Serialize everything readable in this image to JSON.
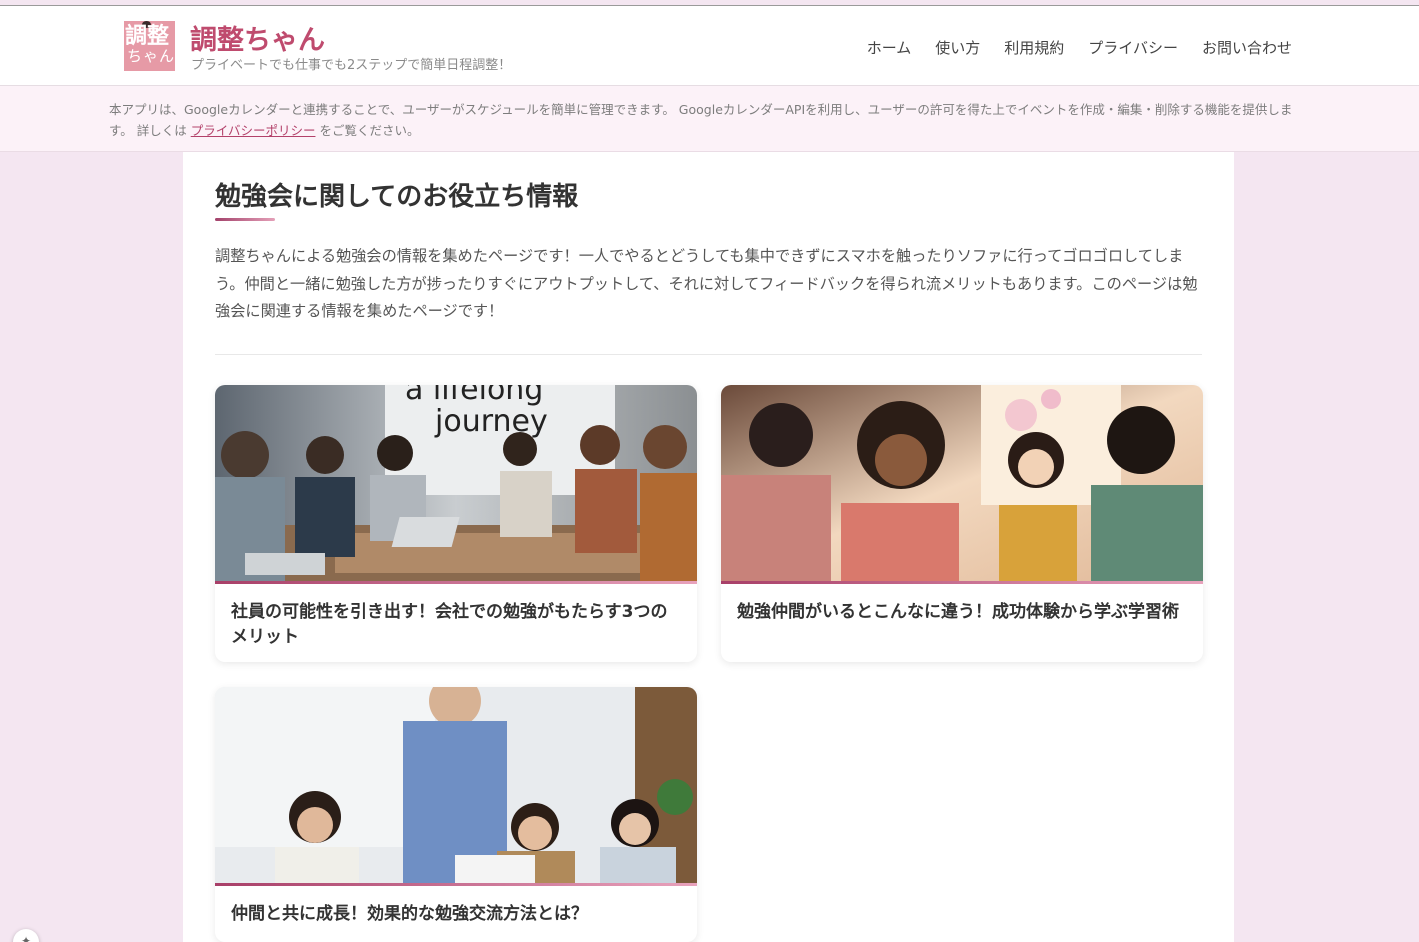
{
  "header": {
    "logo_text_top": "調整",
    "logo_text_bottom": "ちゃん",
    "title": "調整ちゃん",
    "tagline": "プライベートでも仕事でも2ステップで簡単日程調整！"
  },
  "nav": {
    "items": [
      {
        "label": "ホーム"
      },
      {
        "label": "使い方"
      },
      {
        "label": "利用規約"
      },
      {
        "label": "プライバシー"
      },
      {
        "label": "お問い合わせ"
      }
    ]
  },
  "notice": {
    "text_before": "本アプリは、Googleカレンダーと連携することで、ユーザーがスケジュールを簡単に管理できます。 GoogleカレンダーAPIを利用し、ユーザーの許可を得た上でイベントを作成・編集・削除する機能を提供します。 詳しくは ",
    "link_label": "プライバシーポリシー",
    "text_after": " をご覧ください。"
  },
  "main": {
    "title": "勉強会に関してのお役立ち情報",
    "intro": "調整ちゃんによる勉強会の情報を集めたページです！一人でやるとどうしても集中できずにスマホを触ったりソファに行ってゴロゴロしてしまう。仲間と一緒に勉強した方が捗ったりすぐにアウトプットして、それに対してフィードバックを得られ流メリットもあります。このページは勉強会に関連する情報を集めたページです！",
    "cards": [
      {
        "title": "社員の可能性を引き出す！会社での勉強がもたらす3つのメリット",
        "image_caption": "a lifelong journey"
      },
      {
        "title": "勉強仲間がいるとこんなに違う！成功体験から学ぶ学習術"
      },
      {
        "title": "仲間と共に成長！効果的な勉強交流方法とは？"
      }
    ]
  },
  "colors": {
    "accent": "#bf4b6e",
    "page_background": "#f4e6f1",
    "notice_background": "#fcf2f8"
  },
  "floating_button": {
    "icon": "sparkle-icon"
  }
}
